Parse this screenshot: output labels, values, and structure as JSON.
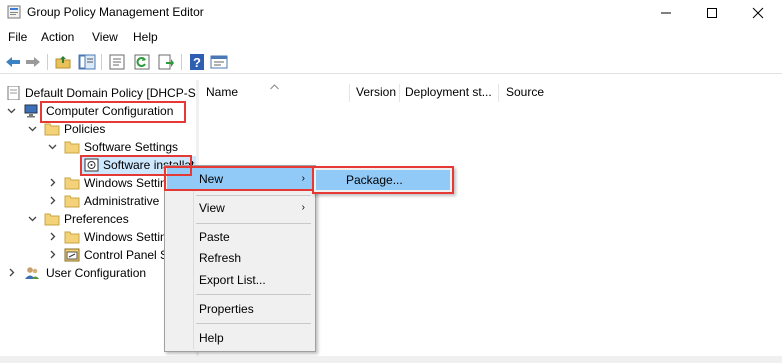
{
  "window": {
    "title": "Group Policy Management Editor"
  },
  "menubar": [
    "File",
    "Action",
    "View",
    "Help"
  ],
  "toolbar": {
    "icons": [
      "back-arrow-icon",
      "forward-arrow-icon",
      "up-folder-icon",
      "show-hide-tree-icon",
      "properties-icon",
      "refresh-icon",
      "export-list-icon",
      "help-icon",
      "show-description-icon"
    ]
  },
  "tree": {
    "root": "Default Domain Policy [DHCP-S",
    "computer_config": "Computer Configuration",
    "policies": "Policies",
    "software_settings": "Software Settings",
    "software_install": "Software installat",
    "windows_settings": "Windows Settin",
    "admin_templates": "Administrative",
    "preferences": "Preferences",
    "pref_windows_settings": "Windows Settin",
    "control_panel": "Control Panel S",
    "user_config": "User Configuration"
  },
  "columns": [
    "Name",
    "Version",
    "Deployment st...",
    "Source"
  ],
  "context_menu": {
    "items": [
      "New",
      "View",
      "Paste",
      "Refresh",
      "Export List...",
      "Properties",
      "Help"
    ],
    "submenu_arrow": "›"
  },
  "submenu": {
    "items": [
      "Package..."
    ]
  },
  "highlight_color": "#e53935",
  "selection_color": "#91c9f7"
}
